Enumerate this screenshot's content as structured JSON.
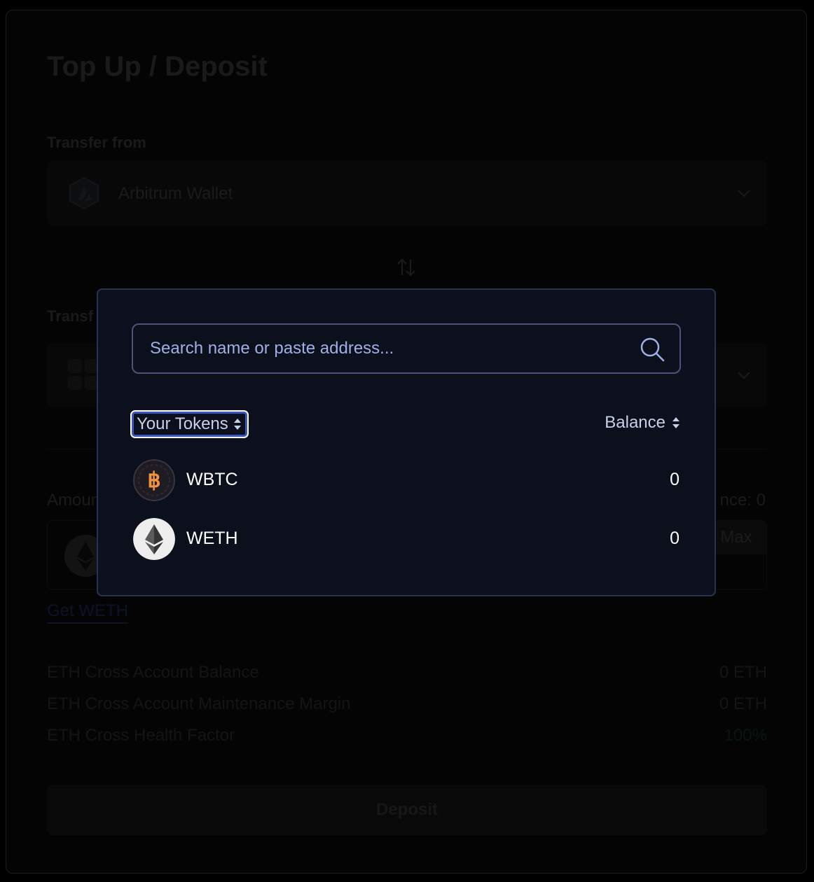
{
  "page": {
    "title": "Top Up / Deposit",
    "transfer_from_label": "Transfer from",
    "transfer_to_label": "Transf",
    "amount_label": "Amour",
    "balance_label": "nce: 0",
    "max_label": "Max",
    "get_weth_label": "Get WETH",
    "deposit_label": "Deposit"
  },
  "transfer_from": {
    "wallet_name": "Arbitrum Wallet",
    "icon": "arbitrum-logo-icon"
  },
  "info_rows": [
    {
      "label": "ETH Cross Account Balance",
      "value": "0 ETH"
    },
    {
      "label": "ETH Cross Account Maintenance Margin",
      "value": "0 ETH"
    },
    {
      "label": "ETH Cross Health Factor",
      "value": "100%"
    }
  ],
  "modal": {
    "search": {
      "placeholder": "Search name or paste address...",
      "value": ""
    },
    "your_tokens_label": "Your Tokens",
    "balance_header": "Balance",
    "tokens": [
      {
        "symbol": "WBTC",
        "balance": "0",
        "icon": "bitcoin-logo-icon"
      },
      {
        "symbol": "WETH",
        "balance": "0",
        "icon": "ethereum-logo-icon"
      }
    ]
  },
  "colors": {
    "accent": "#3a56b8",
    "bitcoin_orange": "#f09242",
    "modal_bg": "#0c0f1c",
    "health_green": "#0f3326"
  }
}
